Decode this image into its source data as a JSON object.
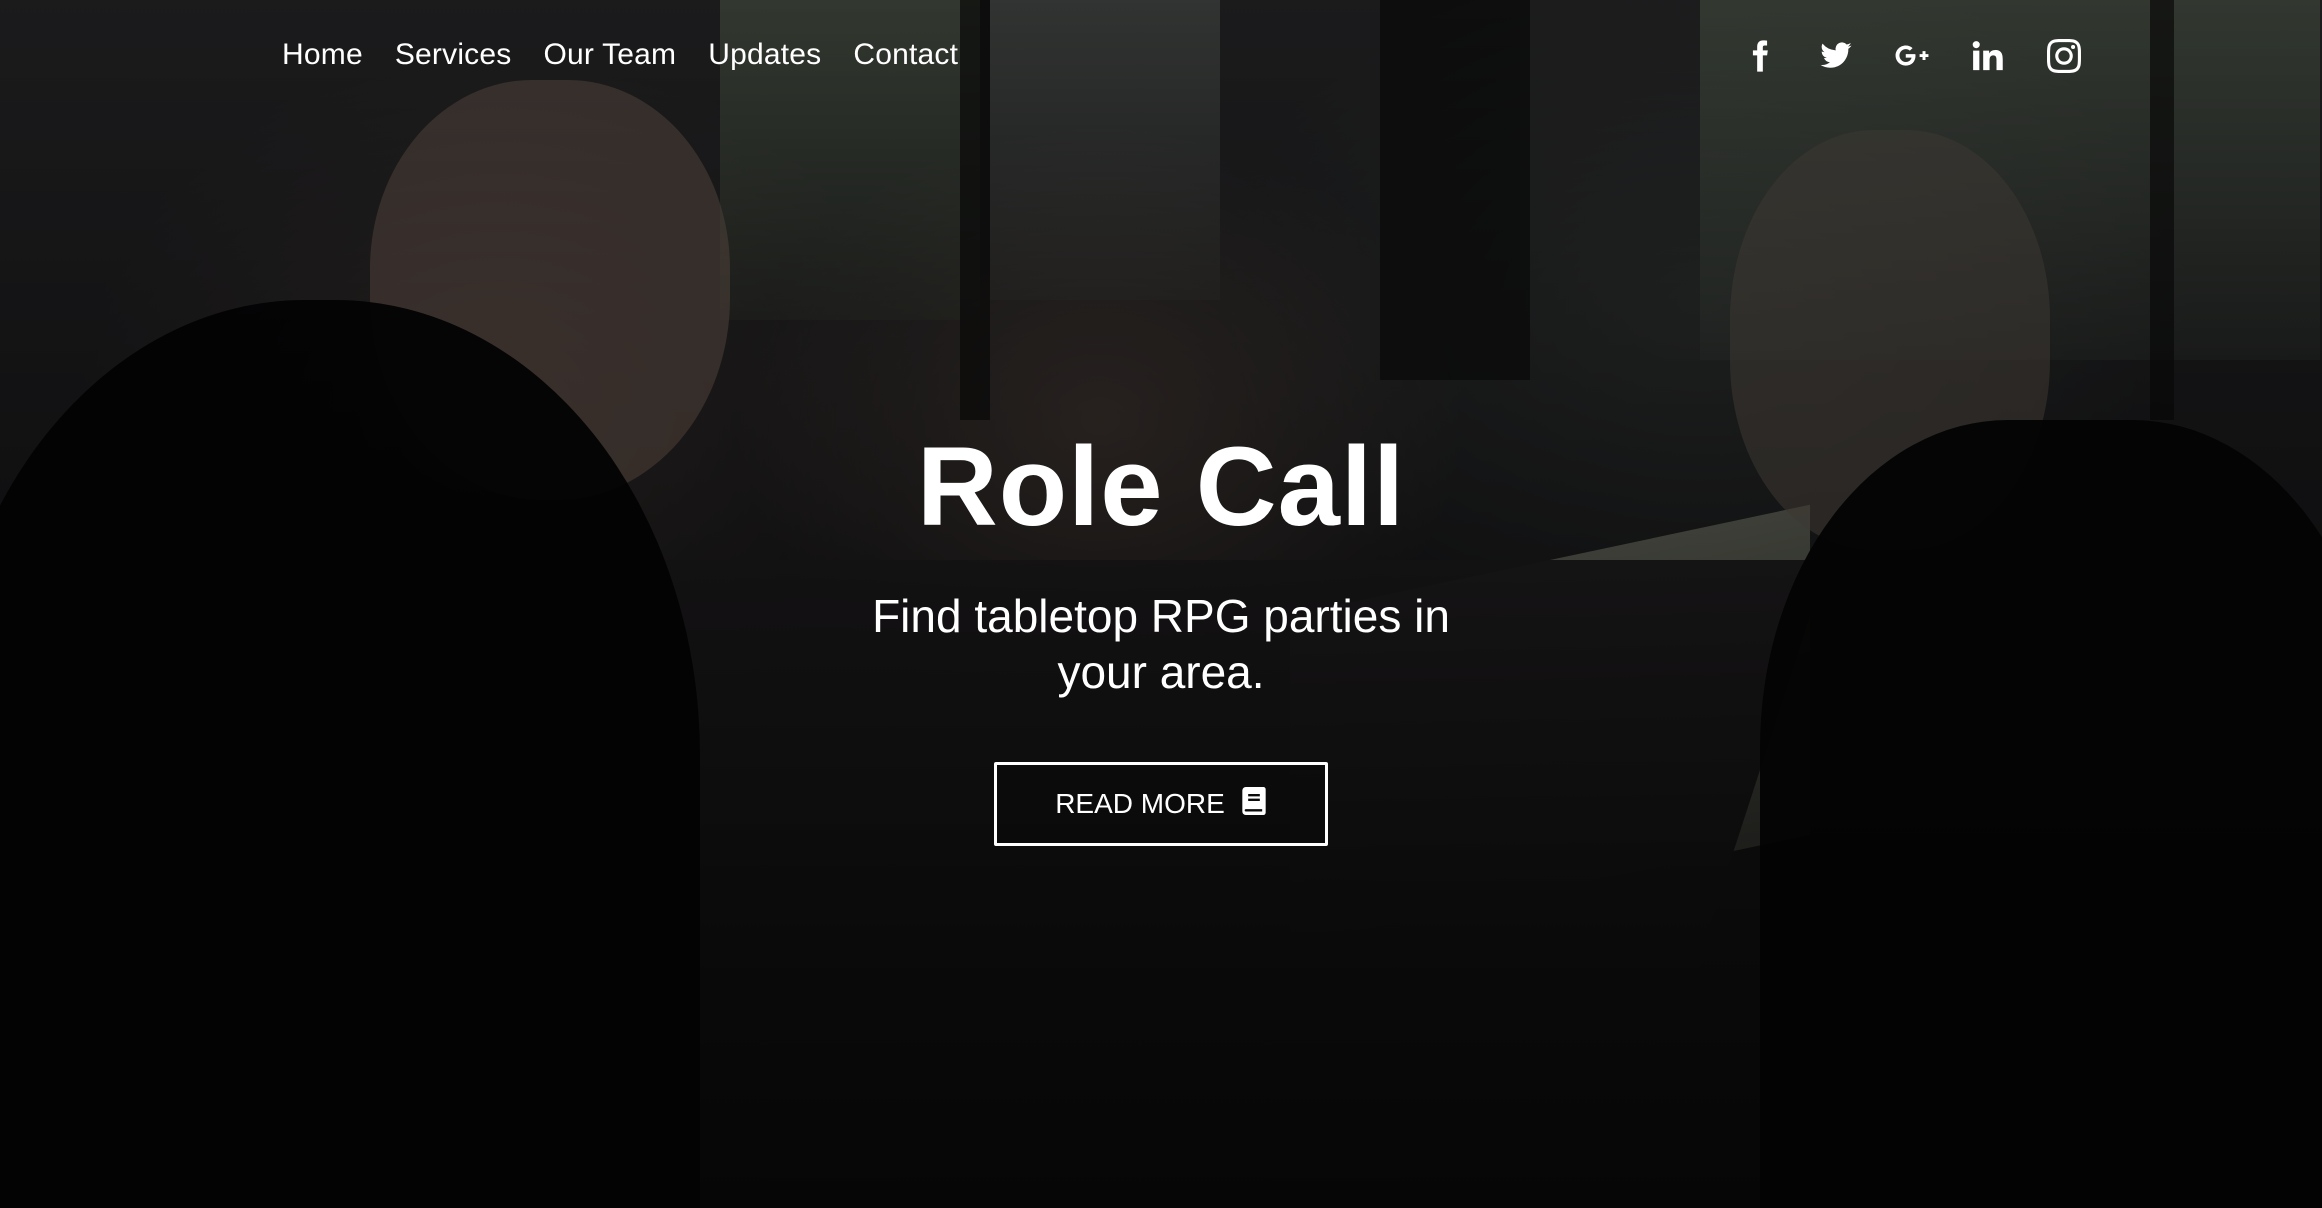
{
  "nav": {
    "items": [
      {
        "label": "Home"
      },
      {
        "label": "Services"
      },
      {
        "label": "Our Team"
      },
      {
        "label": "Updates"
      },
      {
        "label": "Contact"
      }
    ]
  },
  "social": {
    "icons": [
      "facebook-icon",
      "twitter-icon",
      "google-plus-icon",
      "linkedin-icon",
      "instagram-icon"
    ]
  },
  "hero": {
    "title": "Role Call",
    "subtitle": "Find tabletop RPG parties in your area.",
    "button_label": "READ MORE",
    "button_icon": "book-icon"
  },
  "colors": {
    "text": "#ffffff",
    "overlay": "#000000"
  }
}
